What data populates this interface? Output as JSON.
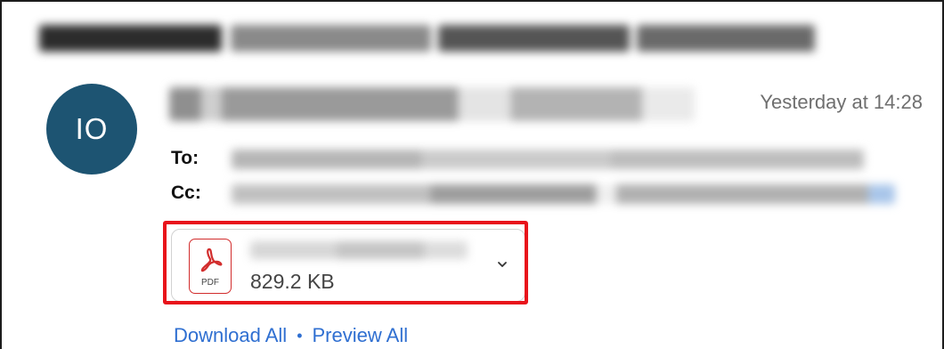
{
  "message": {
    "avatar_initials": "IO",
    "timestamp": "Yesterday at 14:28",
    "to_label": "To:",
    "cc_label": "Cc:"
  },
  "attachment": {
    "file_type": "PDF",
    "size": "829.2 KB",
    "icon": "pdf-icon"
  },
  "actions": {
    "download_all": "Download All",
    "separator": "•",
    "preview_all": "Preview All"
  },
  "colors": {
    "avatar_bg": "#1d5472",
    "link": "#2f6fd1",
    "highlight": "#e8131b",
    "pdf_red": "#d22d2d"
  }
}
